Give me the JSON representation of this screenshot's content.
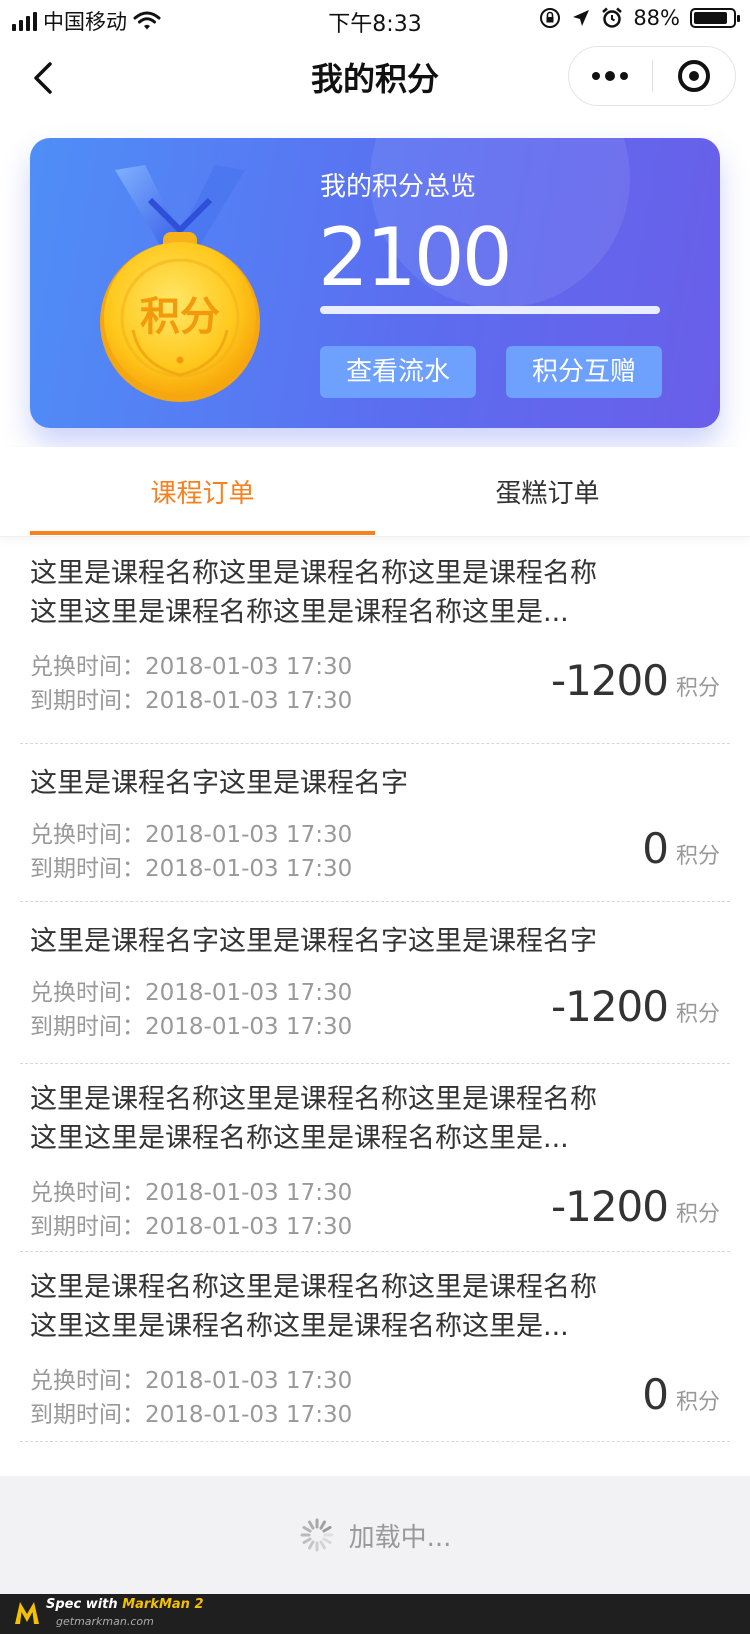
{
  "status_bar": {
    "carrier": "中国移动",
    "time": "下午8:33",
    "battery": "88%"
  },
  "nav": {
    "title": "我的积分"
  },
  "card": {
    "title": "我的积分总览",
    "points": "2100",
    "progress": 1.0,
    "medal_text": "积分",
    "buttons": {
      "flow": "查看流水",
      "gift": "积分互赠"
    }
  },
  "tabs": [
    {
      "label": "课程订单",
      "active": true
    },
    {
      "label": "蛋糕订单",
      "active": false
    }
  ],
  "labels": {
    "exchange_time": "兑换时间：",
    "expire_time": "到期时间：",
    "unit": "积分"
  },
  "orders": [
    {
      "title_lines": [
        "这里是课程名称这里是课程名称这里是课程名称",
        "这里这里是课程名称这里是课程名称这里是..."
      ],
      "exchange_time": "2018-01-03 17:30",
      "expire_time": "2018-01-03 17:30",
      "points": "-1200"
    },
    {
      "title_lines": [
        "这里是课程名字这里是课程名字"
      ],
      "exchange_time": "2018-01-03 17:30",
      "expire_time": "2018-01-03 17:30",
      "points": "0"
    },
    {
      "title_lines": [
        "这里是课程名字这里是课程名字这里是课程名字"
      ],
      "exchange_time": "2018-01-03 17:30",
      "expire_time": "2018-01-03 17:30",
      "points": "-1200"
    },
    {
      "title_lines": [
        "这里是课程名称这里是课程名称这里是课程名称",
        "这里这里是课程名称这里是课程名称这里是..."
      ],
      "exchange_time": "2018-01-03 17:30",
      "expire_time": "2018-01-03 17:30",
      "points": "-1200"
    },
    {
      "title_lines": [
        "这里是课程名称这里是课程名称这里是课程名称",
        "这里这里是课程名称这里是课程名称这里是..."
      ],
      "exchange_time": "2018-01-03 17:30",
      "expire_time": "2018-01-03 17:30",
      "points": "0"
    }
  ],
  "footer": {
    "loading": "加载中..."
  },
  "watermark": {
    "prefix": "Spec with",
    "brand": "MarkMan 2",
    "site": "getmarkman.com"
  },
  "colors": {
    "accent": "#f5821f",
    "card_button": "#6ea0fd",
    "card_gradient_start": "#4f8ef7",
    "card_gradient_end": "#6a5ee9"
  }
}
